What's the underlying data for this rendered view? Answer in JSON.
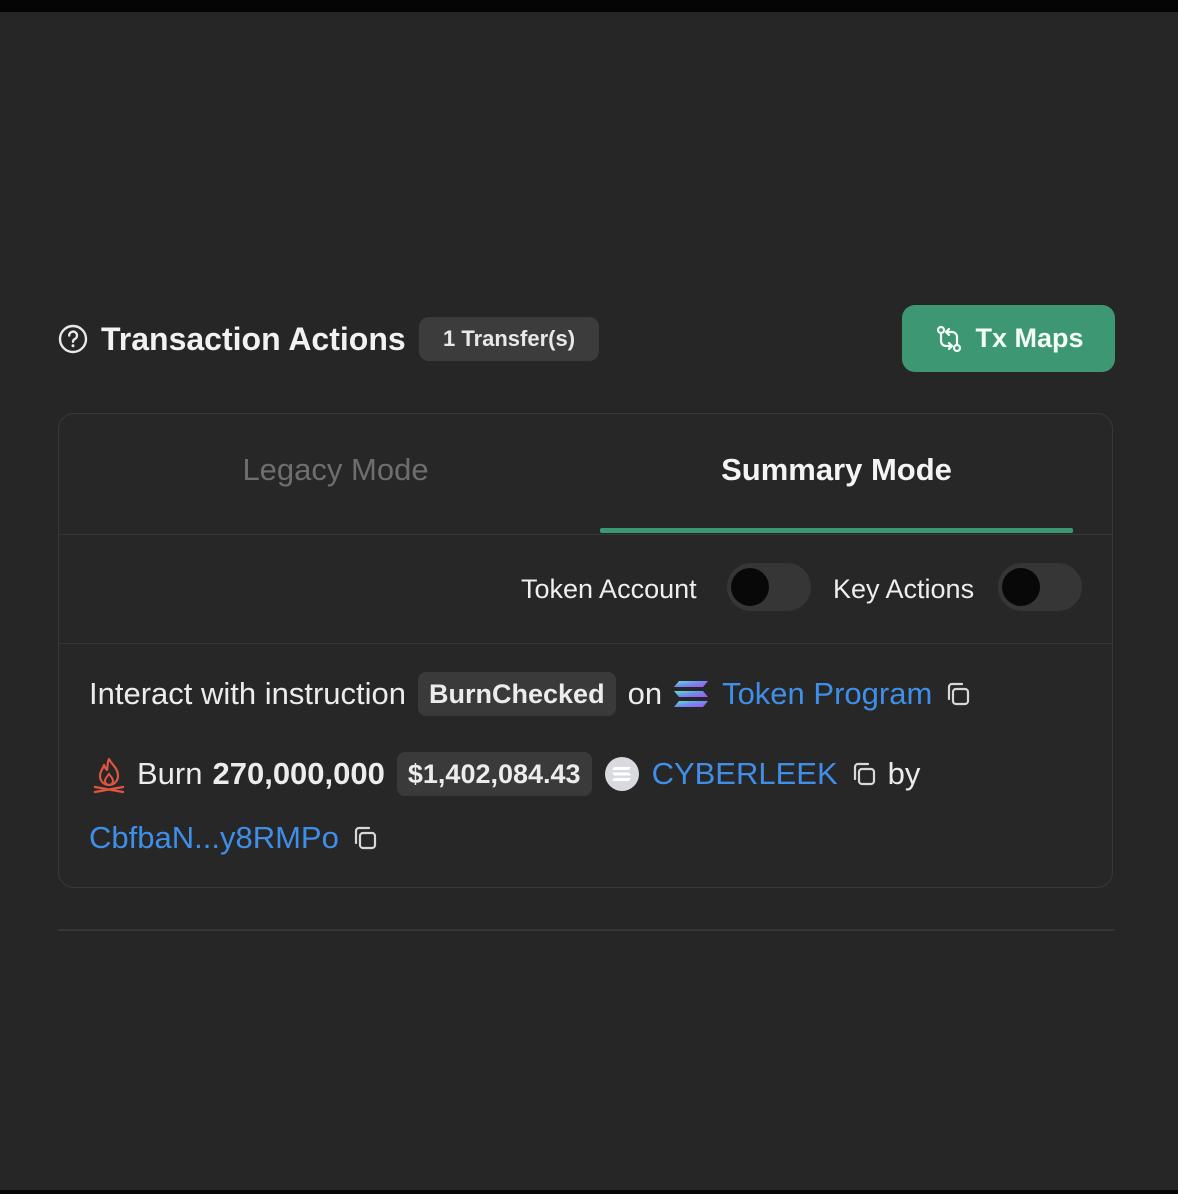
{
  "header": {
    "title": "Transaction Actions",
    "transfer_badge": "1 Transfer(s)",
    "tx_maps_label": "Tx Maps"
  },
  "tabs": [
    {
      "label": "Legacy Mode",
      "active": false
    },
    {
      "label": "Summary Mode",
      "active": true
    }
  ],
  "toggles": [
    {
      "label": "Token Account",
      "enabled": false
    },
    {
      "label": "Key Actions",
      "enabled": false
    }
  ],
  "instruction": {
    "prefix": "Interact with instruction",
    "instruction_name": "BurnChecked",
    "on_text": "on",
    "program_name": "Token Program"
  },
  "action": {
    "verb": "Burn",
    "amount": "270,000,000",
    "usd_value": "$1,402,084.43",
    "token_name": "CYBERLEEK",
    "by_text": "by",
    "account": "CbfbaN...y8RMPo"
  },
  "colors": {
    "background": "#262626",
    "accent_green": "#3d9772",
    "link_blue": "#3f8ee8",
    "burn_red": "#e0553f"
  },
  "icons": {
    "help": "question-circle-icon",
    "tx_maps": "swap-arrows-icon",
    "program": "solana-icon",
    "burn": "campfire-icon",
    "copy": "copy-icon",
    "token": "token-logo-icon"
  }
}
